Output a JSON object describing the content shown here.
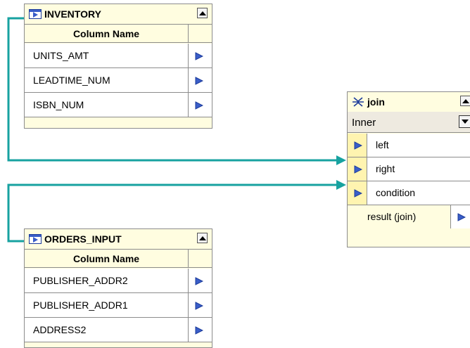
{
  "colors": {
    "connector": "#17a2a0",
    "port_arrow": "#3a5ec8",
    "node_bg": "#fffde0",
    "port_bg": "#fff4b0"
  },
  "inventory": {
    "title": "INVENTORY",
    "icon": "table-icon",
    "column_header": "Column Name",
    "rows": [
      "UNITS_AMT",
      "LEADTIME_NUM",
      "ISBN_NUM"
    ]
  },
  "orders_input": {
    "title": "ORDERS_INPUT",
    "icon": "table-icon",
    "column_header": "Column Name",
    "rows": [
      "PUBLISHER_ADDR2",
      "PUBLISHER_ADDR1",
      "ADDRESS2"
    ]
  },
  "join": {
    "title": "join",
    "icon": "join-icon",
    "join_type": "Inner",
    "inputs": [
      "left",
      "right",
      "condition"
    ],
    "output": "result (join)"
  }
}
